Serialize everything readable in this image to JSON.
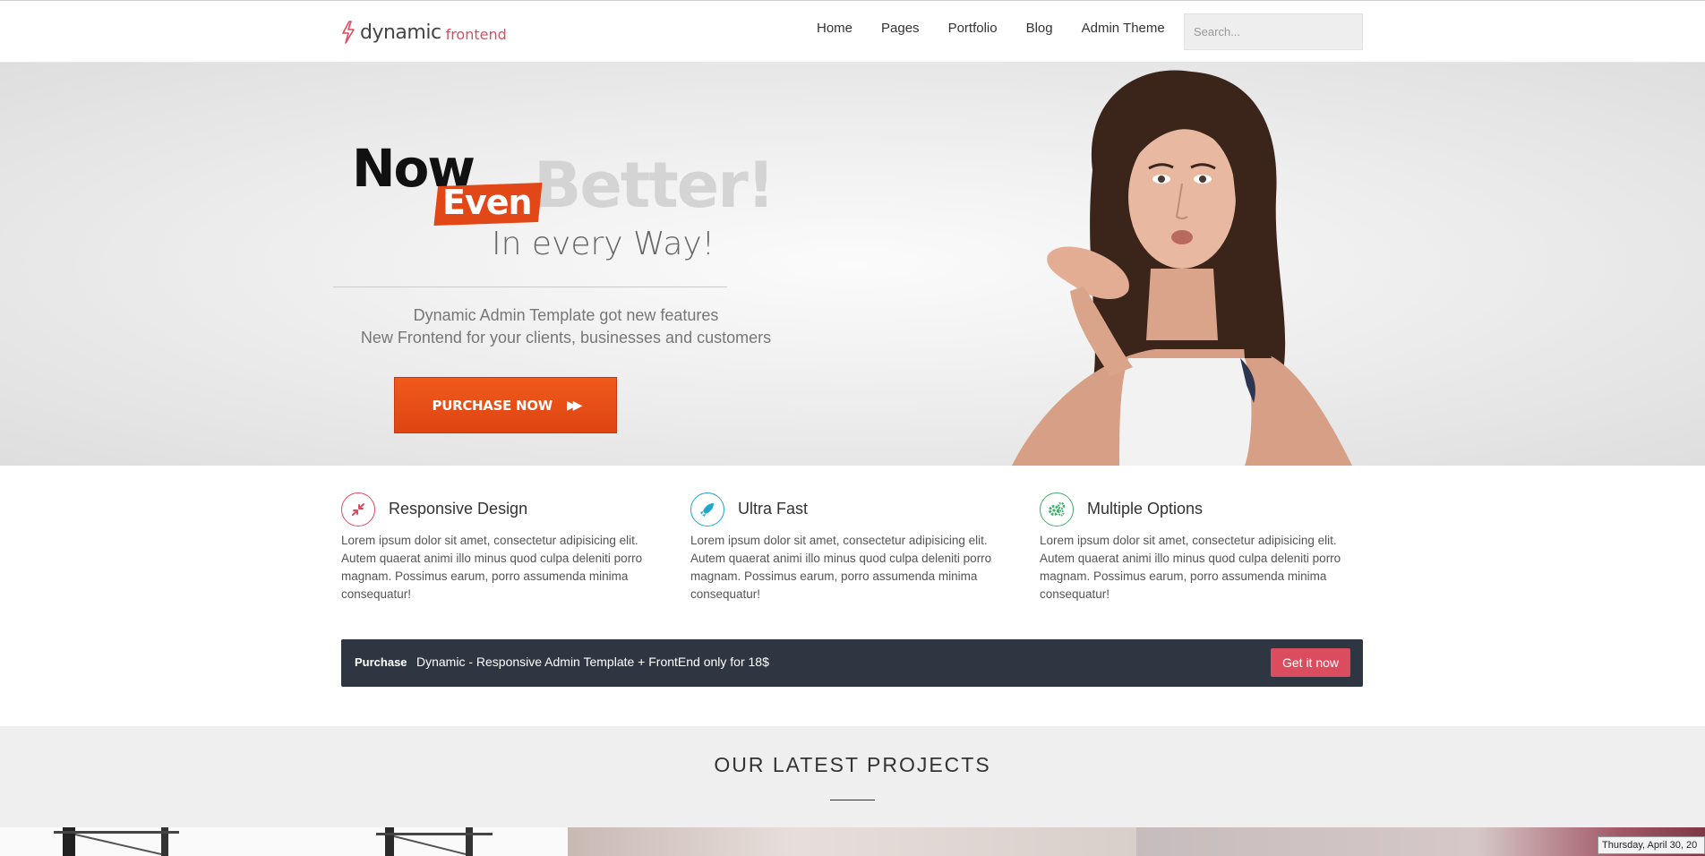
{
  "header": {
    "logo_primary": "dynamic",
    "logo_secondary": "frontend",
    "nav": [
      "Home",
      "Pages",
      "Portfolio",
      "Blog",
      "Admin Theme"
    ],
    "search_placeholder": "Search..."
  },
  "hero": {
    "word_now": "Now",
    "word_even": "Even",
    "word_better": "Better!",
    "tagline": "In every Way!",
    "subtitle_1": "Dynamic Admin Template got new features",
    "subtitle_2": "New Frontend for your clients, businesses and customers",
    "cta_label": "PURCHASE NOW",
    "cta_icon": "fast-forward-icon"
  },
  "features": [
    {
      "icon": "compress-icon",
      "color": "#e04a5f",
      "title": "Responsive Design",
      "text": "Lorem ipsum dolor sit amet, consectetur adipisicing elit. Autem quaerat animi illo minus quod culpa deleniti porro magnam. Possimus earum, porro assumenda minima consequatur!"
    },
    {
      "icon": "rocket-icon",
      "color": "#1ea7c6",
      "title": "Ultra Fast",
      "text": "Lorem ipsum dolor sit amet, consectetur adipisicing elit. Autem quaerat animi illo minus quod culpa deleniti porro magnam. Possimus earum, porro assumenda minima consequatur!"
    },
    {
      "icon": "gears-icon",
      "color": "#3fae6b",
      "title": "Multiple Options",
      "text": "Lorem ipsum dolor sit amet, consectetur adipisicing elit. Autem quaerat animi illo minus quod culpa deleniti porro magnam. Possimus earum, porro assumenda minima consequatur!"
    }
  ],
  "purchase_bar": {
    "label": "Purchase",
    "text": "Dynamic - Responsive Admin Template + FrontEnd only for 18$",
    "button": "Get it now"
  },
  "projects": {
    "heading": "OUR LATEST PROJECTS"
  },
  "clock": "Thursday, April 30, 20"
}
